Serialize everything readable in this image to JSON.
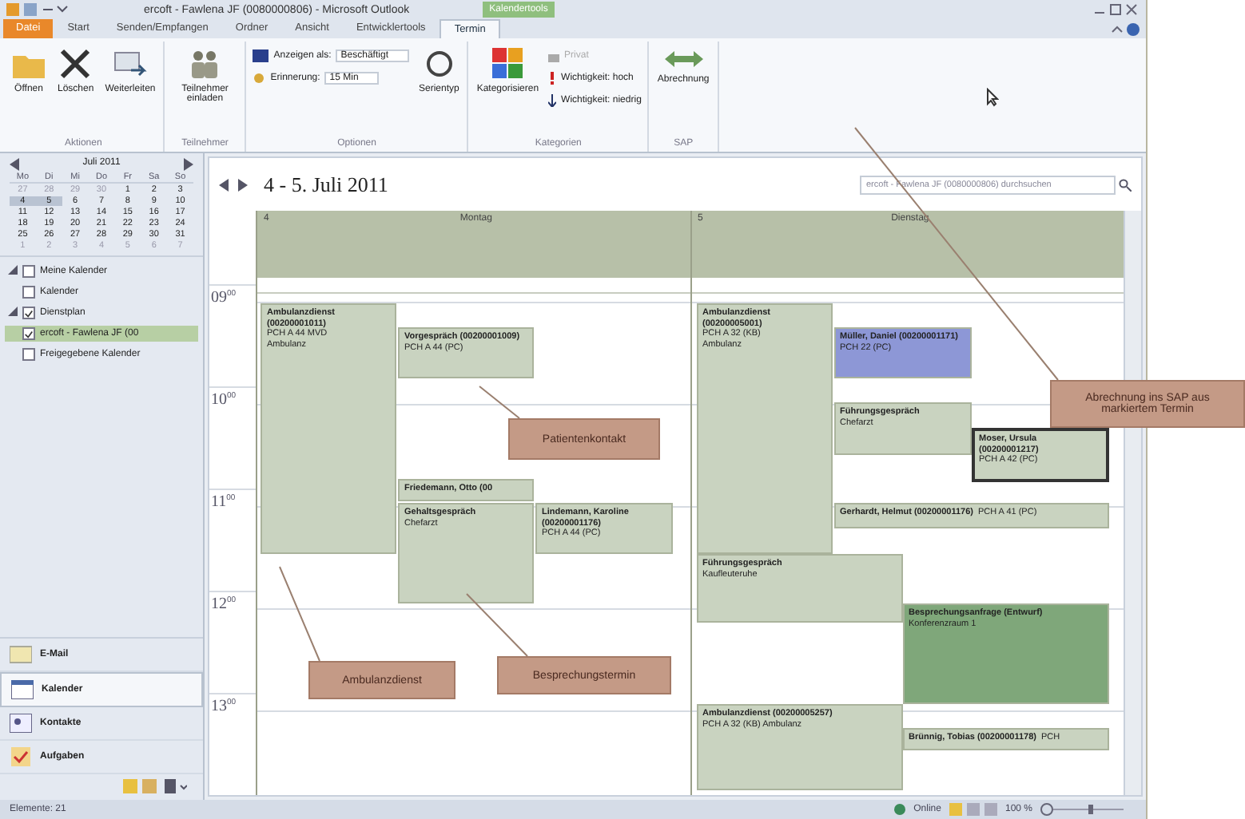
{
  "window": {
    "title": "ercoft - Fawlena JF (0080000806) - Microsoft Outlook",
    "context_tab_group": "Kalendertools"
  },
  "tabs": [
    {
      "label": "Datei",
      "kind": "file",
      "selected": false
    },
    {
      "label": "Start",
      "kind": "tab",
      "selected": false
    },
    {
      "label": "Senden/Empfangen",
      "kind": "tab",
      "selected": false
    },
    {
      "label": "Ordner",
      "kind": "tab",
      "selected": false
    },
    {
      "label": "Ansicht",
      "kind": "tab",
      "selected": false
    },
    {
      "label": "Entwicklertools",
      "kind": "tab",
      "selected": false
    },
    {
      "label": "Termin",
      "kind": "tab",
      "selected": true
    }
  ],
  "ribbon": [
    {
      "group": "Aktionen",
      "items": [
        {
          "kind": "big",
          "label": "Öffnen"
        },
        {
          "kind": "big",
          "label": "Löschen"
        },
        {
          "kind": "big",
          "label": "Weiterleiten"
        }
      ]
    },
    {
      "group": "Teilnehmer",
      "items": [
        {
          "kind": "big",
          "label": "Teilnehmer einladen"
        }
      ]
    },
    {
      "group": "Optionen",
      "items": [
        {
          "kind": "small",
          "label": "Anzeigen als:",
          "value": "Beschäftigt"
        },
        {
          "kind": "small",
          "label": "Erinnerung:",
          "value": "15 Min"
        },
        {
          "kind": "big",
          "label": "Serientyp"
        }
      ]
    },
    {
      "group": "Kategorien",
      "items": [
        {
          "kind": "big",
          "label": "Kategorisieren"
        },
        {
          "kind": "small",
          "label": "Privat",
          "disabled": true
        },
        {
          "kind": "small",
          "label": "Wichtigkeit: hoch",
          "disabled": false
        },
        {
          "kind": "small",
          "label": "Wichtigkeit: niedrig",
          "disabled": false
        }
      ]
    },
    {
      "group": "SAP",
      "items": [
        {
          "kind": "big",
          "label": "Abrechnung"
        }
      ]
    }
  ],
  "sidebar": {
    "month": {
      "title": "Juli 2011",
      "weekdays": [
        "Mo",
        "Di",
        "Mi",
        "Do",
        "Fr",
        "Sa",
        "So"
      ],
      "weeks": [
        [
          {
            "text": "27",
            "muted": true,
            "selected": false
          },
          {
            "text": "28",
            "muted": true,
            "selected": false
          },
          {
            "text": "29",
            "muted": true,
            "selected": false
          },
          {
            "text": "30",
            "muted": true,
            "selected": false
          },
          {
            "text": "1",
            "muted": false,
            "selected": false
          },
          {
            "text": "2",
            "muted": false,
            "selected": false
          },
          {
            "text": "3",
            "muted": false,
            "selected": false
          }
        ],
        [
          {
            "text": "4",
            "muted": false,
            "selected": true
          },
          {
            "text": "5",
            "muted": false,
            "selected": true
          },
          {
            "text": "6",
            "muted": false,
            "selected": false
          },
          {
            "text": "7",
            "muted": false,
            "selected": false
          },
          {
            "text": "8",
            "muted": false,
            "selected": false
          },
          {
            "text": "9",
            "muted": false,
            "selected": false
          },
          {
            "text": "10",
            "muted": false,
            "selected": false
          }
        ],
        [
          {
            "text": "11",
            "muted": false,
            "selected": false
          },
          {
            "text": "12",
            "muted": false,
            "selected": false
          },
          {
            "text": "13",
            "muted": false,
            "selected": false
          },
          {
            "text": "14",
            "muted": false,
            "selected": false
          },
          {
            "text": "15",
            "muted": false,
            "selected": false
          },
          {
            "text": "16",
            "muted": false,
            "selected": false
          },
          {
            "text": "17",
            "muted": false,
            "selected": false
          }
        ],
        [
          {
            "text": "18",
            "muted": false,
            "selected": false
          },
          {
            "text": "19",
            "muted": false,
            "selected": false
          },
          {
            "text": "20",
            "muted": false,
            "selected": false
          },
          {
            "text": "21",
            "muted": false,
            "selected": false
          },
          {
            "text": "22",
            "muted": false,
            "selected": false
          },
          {
            "text": "23",
            "muted": false,
            "selected": false
          },
          {
            "text": "24",
            "muted": false,
            "selected": false
          }
        ],
        [
          {
            "text": "25",
            "muted": false,
            "selected": false
          },
          {
            "text": "26",
            "muted": false,
            "selected": false
          },
          {
            "text": "27",
            "muted": false,
            "selected": false
          },
          {
            "text": "28",
            "muted": false,
            "selected": false
          },
          {
            "text": "29",
            "muted": false,
            "selected": false
          },
          {
            "text": "30",
            "muted": false,
            "selected": false
          },
          {
            "text": "31",
            "muted": false,
            "selected": false
          }
        ],
        [
          {
            "text": "1",
            "muted": true,
            "selected": false
          },
          {
            "text": "2",
            "muted": true,
            "selected": false
          },
          {
            "text": "3",
            "muted": true,
            "selected": false
          },
          {
            "text": "4",
            "muted": true,
            "selected": false
          },
          {
            "text": "5",
            "muted": true,
            "selected": false
          },
          {
            "text": "6",
            "muted": true,
            "selected": false
          },
          {
            "text": "7",
            "muted": true,
            "selected": false
          }
        ]
      ]
    },
    "folders": [
      {
        "label": "Meine Kalender",
        "expanded": true,
        "checked": false,
        "selected": false,
        "children": [
          {
            "label": "Kalender",
            "checked": false,
            "selected": false
          }
        ]
      },
      {
        "label": "Dienstplan",
        "expanded": true,
        "checked": true,
        "selected": false,
        "children": [
          {
            "label": "ercoft - Fawlena JF (00",
            "checked": true,
            "selected": true
          },
          {
            "label": "Freigegebene Kalender",
            "checked": false,
            "selected": false
          }
        ]
      }
    ],
    "nav": [
      {
        "label": "E-Mail",
        "selected": false
      },
      {
        "label": "Kalender",
        "selected": true
      },
      {
        "label": "Kontakte",
        "selected": false
      },
      {
        "label": "Aufgaben",
        "selected": false
      }
    ]
  },
  "calendar": {
    "range": "4 - 5. Juli 2011",
    "search": {
      "placeholder": "ercoft - Fawlena JF (0080000806) durchsuchen"
    },
    "hours": [
      {
        "hour": "09",
        "minutes": "00"
      },
      {
        "hour": "10",
        "minutes": "00"
      },
      {
        "hour": "11",
        "minutes": "00"
      },
      {
        "hour": "12",
        "minutes": "00"
      },
      {
        "hour": "13",
        "minutes": "00"
      }
    ],
    "days": [
      {
        "number": "4",
        "name": "Montag",
        "events": [
          {
            "title": "Ambulanzdienst (00200001011)",
            "details": [
              "PCH A 44 MVD",
              "Ambulanz"
            ],
            "color": "#c9d3c0",
            "selected": false
          },
          {
            "title": "Vorgespräch (00200001009)",
            "details": [
              "PCH A 44 (PC)"
            ],
            "color": "#c9d3c0",
            "selected": false
          },
          {
            "title": "Friedemann, Otto (00",
            "color": "#c9d3c0",
            "selected": false
          },
          {
            "title": "Gehaltsgespräch",
            "details": [
              "Chefarzt"
            ],
            "color": "#c9d3c0",
            "selected": false
          },
          {
            "title": "Lindemann, Karoline (00200001176)",
            "details": [
              "PCH A 44 (PC)"
            ],
            "color": "#c9d3c0",
            "selected": false
          }
        ]
      },
      {
        "number": "5",
        "name": "Dienstag",
        "events": [
          {
            "title": "Ambulanzdienst (00200005001)",
            "details": [
              "PCH A 32 (KB)",
              "Ambulanz"
            ],
            "color": "#c9d3c0",
            "selected": false
          },
          {
            "title": "Müller, Daniel (00200001171)",
            "details": [
              "PCH 22 (PC)"
            ],
            "color": "#8d97d6",
            "selected": false
          },
          {
            "title": "Führungsgespräch",
            "details": [
              "Chefarzt"
            ],
            "color": "#c9d3c0",
            "selected": false
          },
          {
            "title": "Moser, Ursula (00200001217)",
            "details": [
              "PCH A 42 (PC)"
            ],
            "color": "#c9d3c0",
            "selected": true
          },
          {
            "title": "Gerhardt, Helmut (00200001176)",
            "details": [
              "PCH A 41 (PC)"
            ],
            "color": "#c9d3c0",
            "selected": false
          },
          {
            "title": "Führungsgespräch",
            "details": [
              "Kaufleuteruhe"
            ],
            "color": "#c9d3c0",
            "selected": false
          },
          {
            "title": "Besprechungsanfrage (Entwurf)",
            "details": [
              "Konferenzraum 1"
            ],
            "color": "#7fa77a",
            "selected": false
          },
          {
            "title": "Ambulanzdienst (00200005257)",
            "details": [
              "PCH A 32 (KB) Ambulanz"
            ],
            "color": "#c9d3c0",
            "selected": false
          },
          {
            "title": "Brünnig, Tobias (00200001178)",
            "details": [
              "PCH"
            ],
            "color": "#c9d3c0",
            "selected": false
          }
        ]
      }
    ]
  },
  "annotations": [
    {
      "text": "Ambulanzdienst"
    },
    {
      "text": "Patientenkontakt"
    },
    {
      "text": "Besprechungstermin"
    },
    {
      "text": "Abrechnung ins SAP aus markiertem Termin"
    }
  ],
  "status_bar": {
    "items": "Elemente: 21",
    "connection": "Online",
    "zoom": "100 %"
  }
}
